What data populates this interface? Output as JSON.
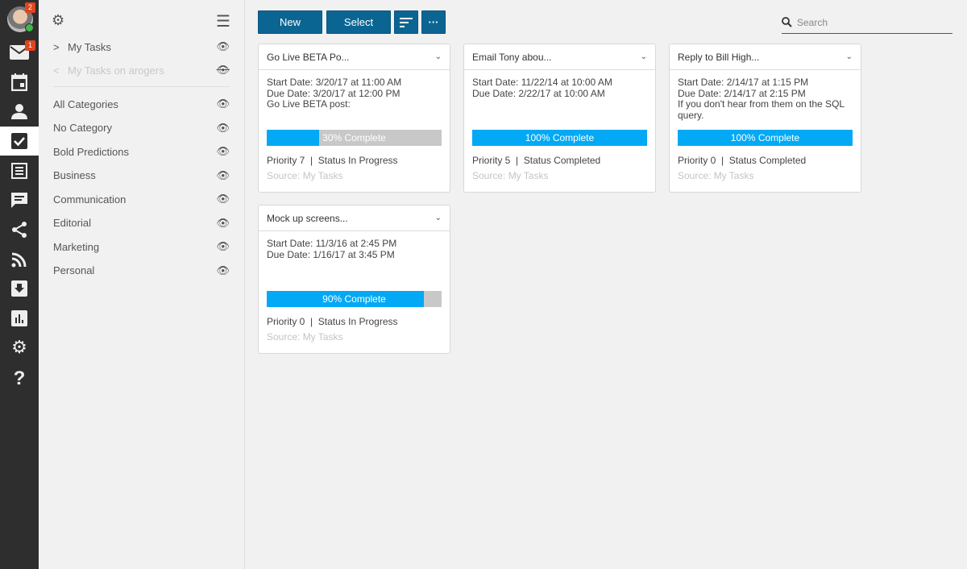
{
  "rail": {
    "avatar_badge": "2",
    "mail_badge": "1",
    "active": "tasks",
    "icons": [
      "mail-icon",
      "calendar-icon",
      "contacts-icon",
      "tasks-icon",
      "notes-icon",
      "chat-icon",
      "share-icon",
      "rss-icon",
      "download-icon",
      "reports-icon",
      "settings-icon",
      "help-icon"
    ]
  },
  "sidebar": {
    "sources": [
      {
        "label": "My Tasks",
        "visible": true
      },
      {
        "label": "My Tasks on arogers",
        "visible": false
      }
    ],
    "categories": [
      "All Categories",
      "No Category",
      "Bold Predictions",
      "Business",
      "Communication",
      "Editorial",
      "Marketing",
      "Personal"
    ]
  },
  "toolbar": {
    "new_label": "New",
    "select_label": "Select",
    "search_placeholder": "Search"
  },
  "colors": {
    "accent": "#0b6593",
    "progress": "#03a9f4",
    "rail": "#2e2e2e"
  },
  "cards": [
    {
      "title": "Go Live BETA Po...",
      "lines": [
        "Start Date: 3/20/17 at 11:00 AM",
        "Due Date: 3/20/17 at 12:00 PM",
        "Go Live BETA post:"
      ],
      "percent": 30,
      "progress_label": "30% Complete",
      "meta": "Priority 7  |  Status In Progress",
      "source": "Source: My Tasks"
    },
    {
      "title": "Email Tony abou...",
      "lines": [
        "Start Date: 11/22/14 at 10:00 AM",
        "Due Date: 2/22/17 at 10:00 AM"
      ],
      "percent": 100,
      "progress_label": "100% Complete",
      "meta": "Priority 5  |  Status Completed",
      "source": "Source: My Tasks"
    },
    {
      "title": "Reply to Bill High...",
      "lines": [
        "Start Date: 2/14/17 at 1:15 PM",
        "Due Date: 2/14/17 at 2:15 PM",
        "If you don't hear from them on the SQL query."
      ],
      "percent": 100,
      "progress_label": "100% Complete",
      "meta": "Priority 0  |  Status Completed",
      "source": "Source: My Tasks"
    },
    {
      "title": "Mock up screens...",
      "lines": [
        "Start Date: 11/3/16 at 2:45 PM",
        "Due Date: 1/16/17 at 3:45 PM"
      ],
      "percent": 90,
      "progress_label": "90% Complete",
      "meta": "Priority 0  |  Status In Progress",
      "source": "Source: My Tasks"
    }
  ]
}
